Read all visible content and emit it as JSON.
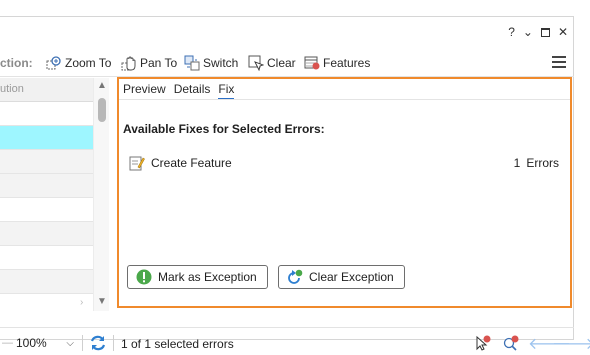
{
  "window": {
    "help_glyph": "?",
    "dropdown_glyph": "⌄",
    "close_glyph": "✕"
  },
  "toolbar": {
    "label_partial": "ction:",
    "buttons": {
      "zoom_to": "Zoom To",
      "pan_to": "Pan To",
      "switch": "Switch",
      "clear": "Clear",
      "features": "Features"
    }
  },
  "grid": {
    "header_partial": "ution"
  },
  "detail": {
    "tabs": [
      "Preview",
      "Details",
      "Fix"
    ],
    "active_tab": "Fix",
    "section_title": "Available Fixes for Selected Errors:",
    "fixes": [
      {
        "name": "Create Feature",
        "count": "1",
        "unit": "Errors"
      }
    ],
    "mark_exception_label": "Mark as Exception",
    "clear_exception_label": "Clear Exception"
  },
  "statusbar": {
    "zoom_level": "100%",
    "selection_text": "1 of 1 selected errors"
  },
  "colors": {
    "accent_orange": "#f08a2c",
    "selected_row": "#9ef6ff",
    "tab_underline": "#2b6fc7",
    "exception_green": "#4aa84a",
    "refresh_blue": "#2e7fd0"
  }
}
